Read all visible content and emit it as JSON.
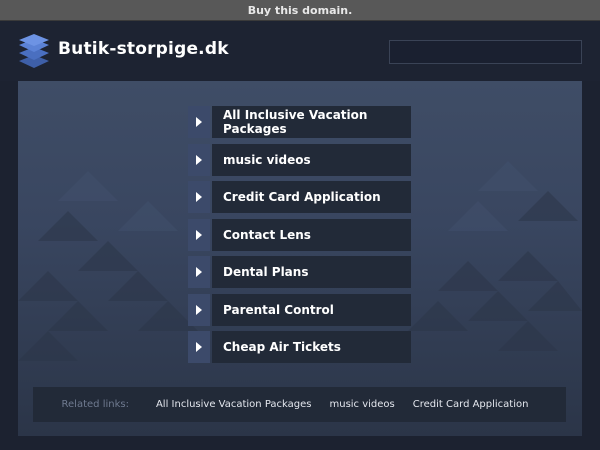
{
  "top_bar": {
    "label": "Buy this domain."
  },
  "header": {
    "title": "Butik-storpige.dk",
    "search_value": "",
    "logo_icon": "stacked-layers-icon"
  },
  "menu": {
    "items": [
      {
        "label": "All Inclusive Vacation Packages",
        "icon": "play-arrow-icon"
      },
      {
        "label": "music videos",
        "icon": "play-arrow-icon"
      },
      {
        "label": "Credit Card Application",
        "icon": "play-arrow-icon"
      },
      {
        "label": "Contact Lens",
        "icon": "play-arrow-icon"
      },
      {
        "label": "Dental Plans",
        "icon": "play-arrow-icon"
      },
      {
        "label": "Parental Control",
        "icon": "play-arrow-icon"
      },
      {
        "label": "Cheap Air Tickets",
        "icon": "play-arrow-icon"
      }
    ]
  },
  "related": {
    "label": "Related links:",
    "links": [
      "All Inclusive Vacation Packages",
      "music videos",
      "Credit Card Application"
    ]
  },
  "colors": {
    "top_bar": "#585858",
    "header_bg": "#1d2332",
    "panel_top": "#3f4d66",
    "menu_arrow_box": "#3c4a6a",
    "menu_label_box": "#222a38"
  }
}
